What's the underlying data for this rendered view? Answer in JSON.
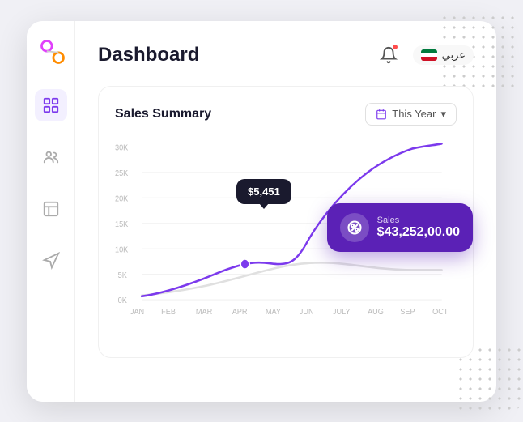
{
  "app": {
    "title": "Dashboard"
  },
  "header": {
    "page_title": "Dashboard",
    "language": "عربي",
    "notification_count": 1
  },
  "sales_card": {
    "title": "Sales Summary",
    "year_selector_label": "This Year",
    "y_labels": [
      "30K",
      "25K",
      "20K",
      "15K",
      "10K",
      "5K",
      "0K"
    ],
    "x_labels": [
      "JAN",
      "FEB",
      "MAR",
      "APR",
      "MAY",
      "JUN",
      "JULY",
      "AUG",
      "SEP",
      "OCT"
    ],
    "tooltip_value": "$5,451",
    "sales_badge": {
      "label": "Sales",
      "value": "$43,252,00.00"
    }
  },
  "sidebar": {
    "items": [
      {
        "name": "dashboard",
        "label": "Dashboard",
        "active": true
      },
      {
        "name": "users",
        "label": "Users",
        "active": false
      },
      {
        "name": "layout",
        "label": "Layout",
        "active": false
      },
      {
        "name": "marketing",
        "label": "Marketing",
        "active": false
      }
    ]
  },
  "icons": {
    "grid": "⊞",
    "users": "👥",
    "layout": "▦",
    "megaphone": "📢",
    "bell": "🔔",
    "calendar": "📅",
    "chevron_down": "▾",
    "percent": "%"
  }
}
